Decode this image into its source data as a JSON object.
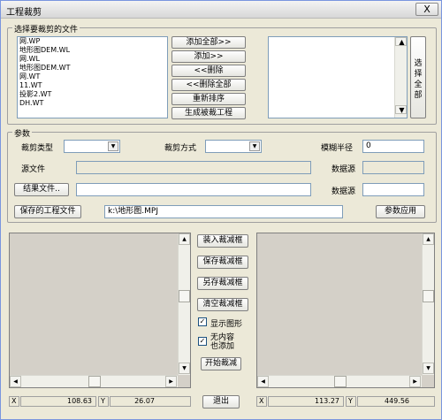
{
  "window": {
    "title": "工程裁剪",
    "close": "X"
  },
  "file_group": {
    "label": "选择要裁剪的文件",
    "files": [
      "网.WP",
      "地形图DEM.WL",
      "网.WL",
      "地形图DEM.WT",
      "网.WT",
      "11.WT",
      "投影2.WT",
      "DH.WT"
    ],
    "buttons": {
      "add_all": "添加全部>>",
      "add": "添加>>",
      "remove": "<<删除",
      "remove_all": "<<删除全部",
      "resort": "重新排序",
      "generate": "生成被裁工程"
    },
    "select_all": "选择全部"
  },
  "params": {
    "label": "参数",
    "clip_type_label": "裁剪类型",
    "clip_type_value": "",
    "clip_mode_label": "裁剪方式",
    "clip_mode_value": "",
    "fuzzy_radius_label": "模糊半径",
    "fuzzy_radius_value": "0",
    "source_label": "源文件",
    "source_value": "",
    "data_source1_label": "数据源",
    "data_source1_value": "",
    "result_button": "结果文件..",
    "result_value": "",
    "data_source2_label": "数据源",
    "data_source2_value": "",
    "save_project_button": "保存的工程文件",
    "project_path": "k:\\地形图.MPJ",
    "apply_button": "参数应用"
  },
  "middle": {
    "load_box": "装入裁减框",
    "save_box": "保存裁减框",
    "save_as_box": "另存裁减框",
    "clear_box": "清空裁减框",
    "show_graphics": "显示图形",
    "no_content_add": "无内容也添加",
    "start_clip": "开始裁减",
    "exit": "退出"
  },
  "status_left": {
    "x_label": "X",
    "x_value": "108.63",
    "y_label": "Y",
    "y_value": "26.07"
  },
  "status_right": {
    "x_label": "X",
    "x_value": "113.27",
    "y_label": "Y",
    "y_value": "449.56"
  }
}
